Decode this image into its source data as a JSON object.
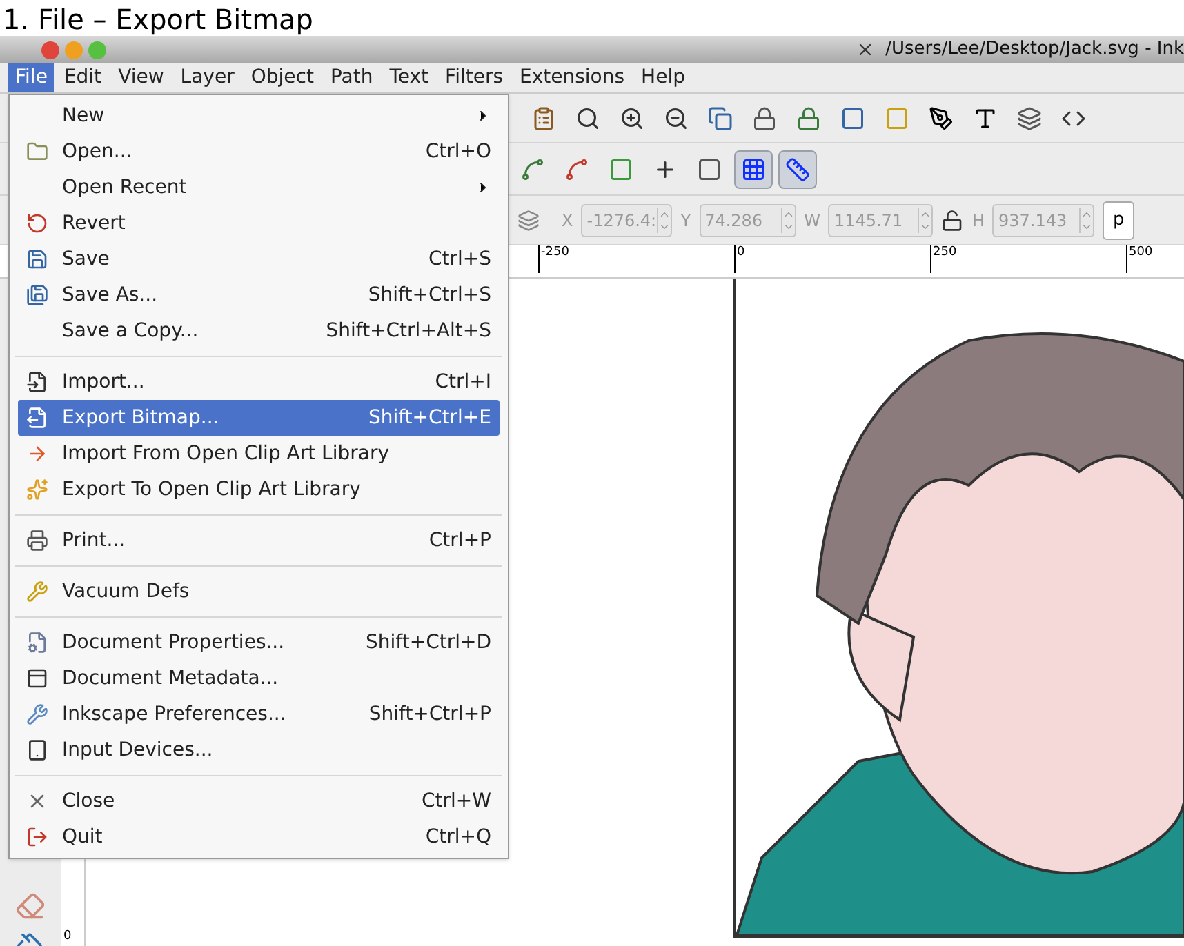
{
  "heading": "1. File – Export Bitmap",
  "window": {
    "title": "/Users/Lee/Desktop/Jack.svg - Ink"
  },
  "menubar": [
    {
      "label": "File",
      "selected": true
    },
    {
      "label": "Edit",
      "selected": false
    },
    {
      "label": "View",
      "selected": false
    },
    {
      "label": "Layer",
      "selected": false
    },
    {
      "label": "Object",
      "selected": false
    },
    {
      "label": "Path",
      "selected": false
    },
    {
      "label": "Text",
      "selected": false
    },
    {
      "label": "Filters",
      "selected": false
    },
    {
      "label": "Extensions",
      "selected": false
    },
    {
      "label": "Help",
      "selected": false
    }
  ],
  "file_menu": [
    [
      {
        "label": "New",
        "submenu": true,
        "selected": false
      },
      {
        "label": "Open...",
        "shortcut": "Ctrl+O",
        "selected": false
      },
      {
        "label": "Open Recent",
        "submenu": true,
        "selected": false
      },
      {
        "label": "Revert",
        "selected": false
      },
      {
        "label": "Save",
        "shortcut": "Ctrl+S",
        "selected": false
      },
      {
        "label": "Save As...",
        "shortcut": "Shift+Ctrl+S",
        "selected": false
      },
      {
        "label": "Save a Copy...",
        "shortcut": "Shift+Ctrl+Alt+S",
        "selected": false
      }
    ],
    [
      {
        "label": "Import...",
        "shortcut": "Ctrl+I",
        "selected": false
      },
      {
        "label": "Export Bitmap...",
        "shortcut": "Shift+Ctrl+E",
        "selected": true
      },
      {
        "label": "Import From Open Clip Art Library",
        "selected": false
      },
      {
        "label": "Export To Open Clip Art Library",
        "selected": false
      }
    ],
    [
      {
        "label": "Print...",
        "shortcut": "Ctrl+P",
        "selected": false
      }
    ],
    [
      {
        "label": "Vacuum Defs",
        "selected": false
      }
    ],
    [
      {
        "label": "Document Properties...",
        "shortcut": "Shift+Ctrl+D",
        "selected": false
      },
      {
        "label": "Document Metadata...",
        "selected": false
      },
      {
        "label": "Inkscape Preferences...",
        "shortcut": "Shift+Ctrl+P",
        "selected": false
      },
      {
        "label": "Input Devices...",
        "selected": false
      }
    ],
    [
      {
        "label": "Close",
        "shortcut": "Ctrl+W",
        "selected": false
      },
      {
        "label": "Quit",
        "shortcut": "Ctrl+Q",
        "selected": false
      }
    ]
  ],
  "snap_toggles": [
    {
      "on": false
    },
    {
      "on": false
    },
    {
      "on": false
    },
    {
      "on": false
    },
    {
      "on": false
    },
    {
      "on": true
    },
    {
      "on": true
    }
  ],
  "select_toolbar": {
    "fields": [
      {
        "label": "X",
        "value": "-1276.4:",
        "disabled": true
      },
      {
        "label": "Y",
        "value": "74.286",
        "disabled": true
      },
      {
        "label": "W",
        "value": "1145.71",
        "disabled": true
      },
      {
        "label": "H",
        "value": "937.143",
        "disabled": true
      }
    ],
    "unit_button": "p"
  },
  "ruler": [
    "-250",
    "0",
    "250",
    "500"
  ],
  "vertical_ruler": [
    "0"
  ]
}
